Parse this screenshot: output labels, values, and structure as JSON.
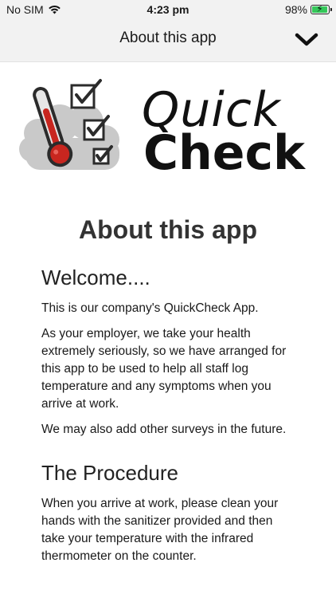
{
  "status_bar": {
    "carrier": "No SIM",
    "time": "4:23 pm",
    "battery": "98%",
    "battery_level": 0.98
  },
  "nav": {
    "title": "About this app",
    "chevron_icon": "chevron-down-icon"
  },
  "logo": {
    "line1": "Quick",
    "line2": "Check"
  },
  "page": {
    "title": "About this app",
    "sections": [
      {
        "heading": "Welcome....",
        "paragraphs": [
          "This is our company's QuickCheck App.",
          "As your employer, we take your health extremely seriously, so we have arranged for this app to be used to help all staff log temperature and any symptoms when you arrive at work.",
          "We may also add other surveys in the future."
        ]
      },
      {
        "heading": "The Procedure",
        "paragraphs": [
          "When you arrive at work, please clean your hands with the sanitizer provided and then take your temperature with the infrared thermometer on the counter."
        ]
      }
    ]
  },
  "colors": {
    "bar_bg": "#f2f2f2",
    "battery_green": "#34c759",
    "thermo_red": "#c8261f"
  }
}
